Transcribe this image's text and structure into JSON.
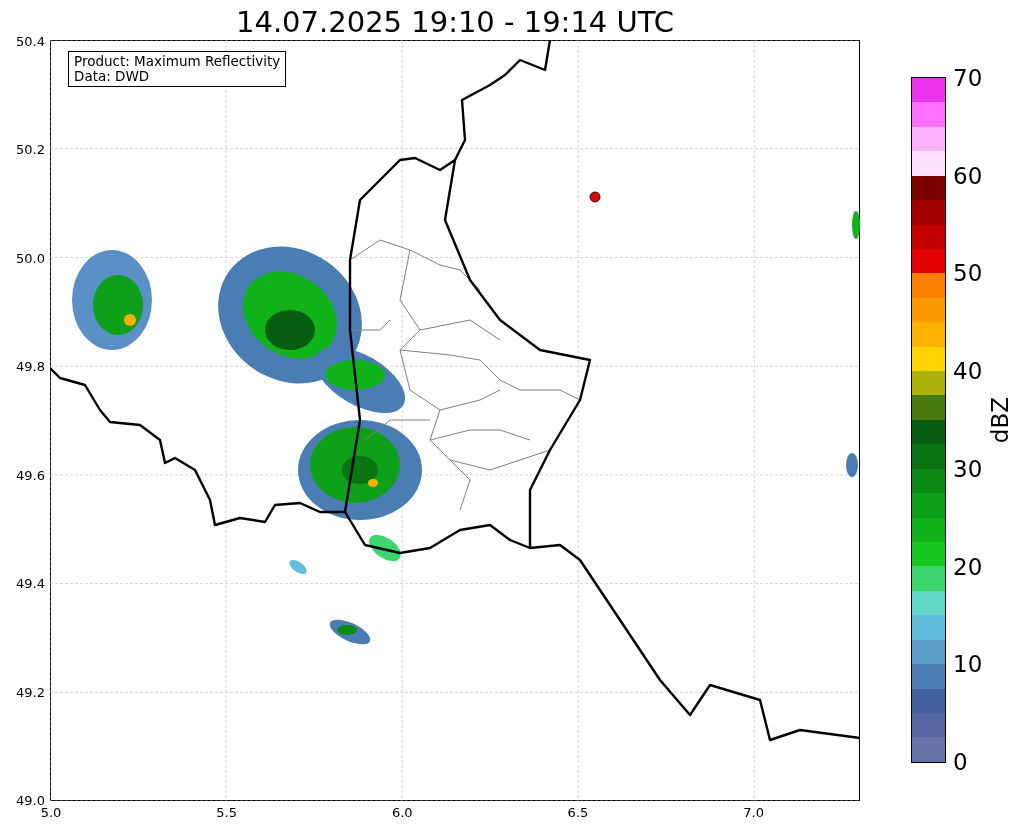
{
  "title": "14.07.2025 19:10 - 19:14 UTC",
  "map": {
    "info_lines": [
      "Product: Maximum Reflectivity",
      "Data: DWD"
    ],
    "x_ticks": [
      "5.0",
      "5.5",
      "6.0",
      "6.5",
      "7.0"
    ],
    "y_ticks": [
      "50.4",
      "50.2",
      "50.0",
      "49.8",
      "49.6",
      "49.4",
      "49.2",
      "49.0"
    ]
  },
  "colorbar": {
    "label": "dBZ",
    "ticks": [
      "70",
      "60",
      "50",
      "40",
      "30",
      "20",
      "10",
      "0"
    ],
    "bins": [
      {
        "color": "#ee33ee"
      },
      {
        "color": "#ff70ff"
      },
      {
        "color": "#ffb3ff"
      },
      {
        "color": "#ffe0ff"
      },
      {
        "color": "#7d0000"
      },
      {
        "color": "#a20000"
      },
      {
        "color": "#c40000"
      },
      {
        "color": "#e20000"
      },
      {
        "color": "#ff7f00"
      },
      {
        "color": "#ff9900"
      },
      {
        "color": "#ffb300"
      },
      {
        "color": "#ffd500"
      },
      {
        "color": "#acb00a"
      },
      {
        "color": "#487a0f"
      },
      {
        "color": "#085e10"
      },
      {
        "color": "#0a7312"
      },
      {
        "color": "#0b8a14"
      },
      {
        "color": "#0ea018"
      },
      {
        "color": "#10b41a"
      },
      {
        "color": "#12c81c"
      },
      {
        "color": "#3dd66e"
      },
      {
        "color": "#62d7c9"
      },
      {
        "color": "#63bede"
      },
      {
        "color": "#5a9dc8"
      },
      {
        "color": "#4a7db3"
      },
      {
        "color": "#45609f"
      },
      {
        "color": "#5566a0"
      },
      {
        "color": "#6474a8"
      }
    ]
  }
}
